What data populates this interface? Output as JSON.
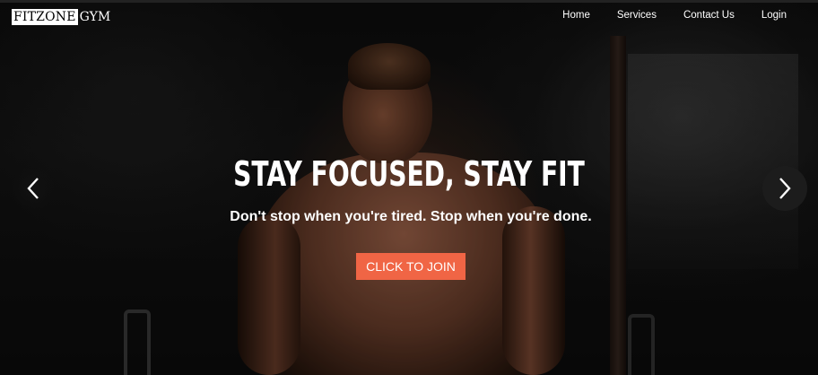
{
  "brand": {
    "logo_part1": "FITZONE",
    "logo_part2": "GYM"
  },
  "nav": {
    "items": [
      {
        "label": "Home"
      },
      {
        "label": "Services"
      },
      {
        "label": "Contact Us"
      },
      {
        "label": "Login"
      }
    ]
  },
  "hero": {
    "title": "STAY FOCUSED, STAY FIT",
    "subtitle": "Don't stop when you're tired. Stop when you're done.",
    "cta_label": "CLICK TO JOIN"
  },
  "carousel": {
    "prev_icon": "chevron-left-icon",
    "next_icon": "chevron-right-icon"
  },
  "colors": {
    "cta": "#f06545",
    "text": "#ffffff",
    "background": "#000000"
  }
}
